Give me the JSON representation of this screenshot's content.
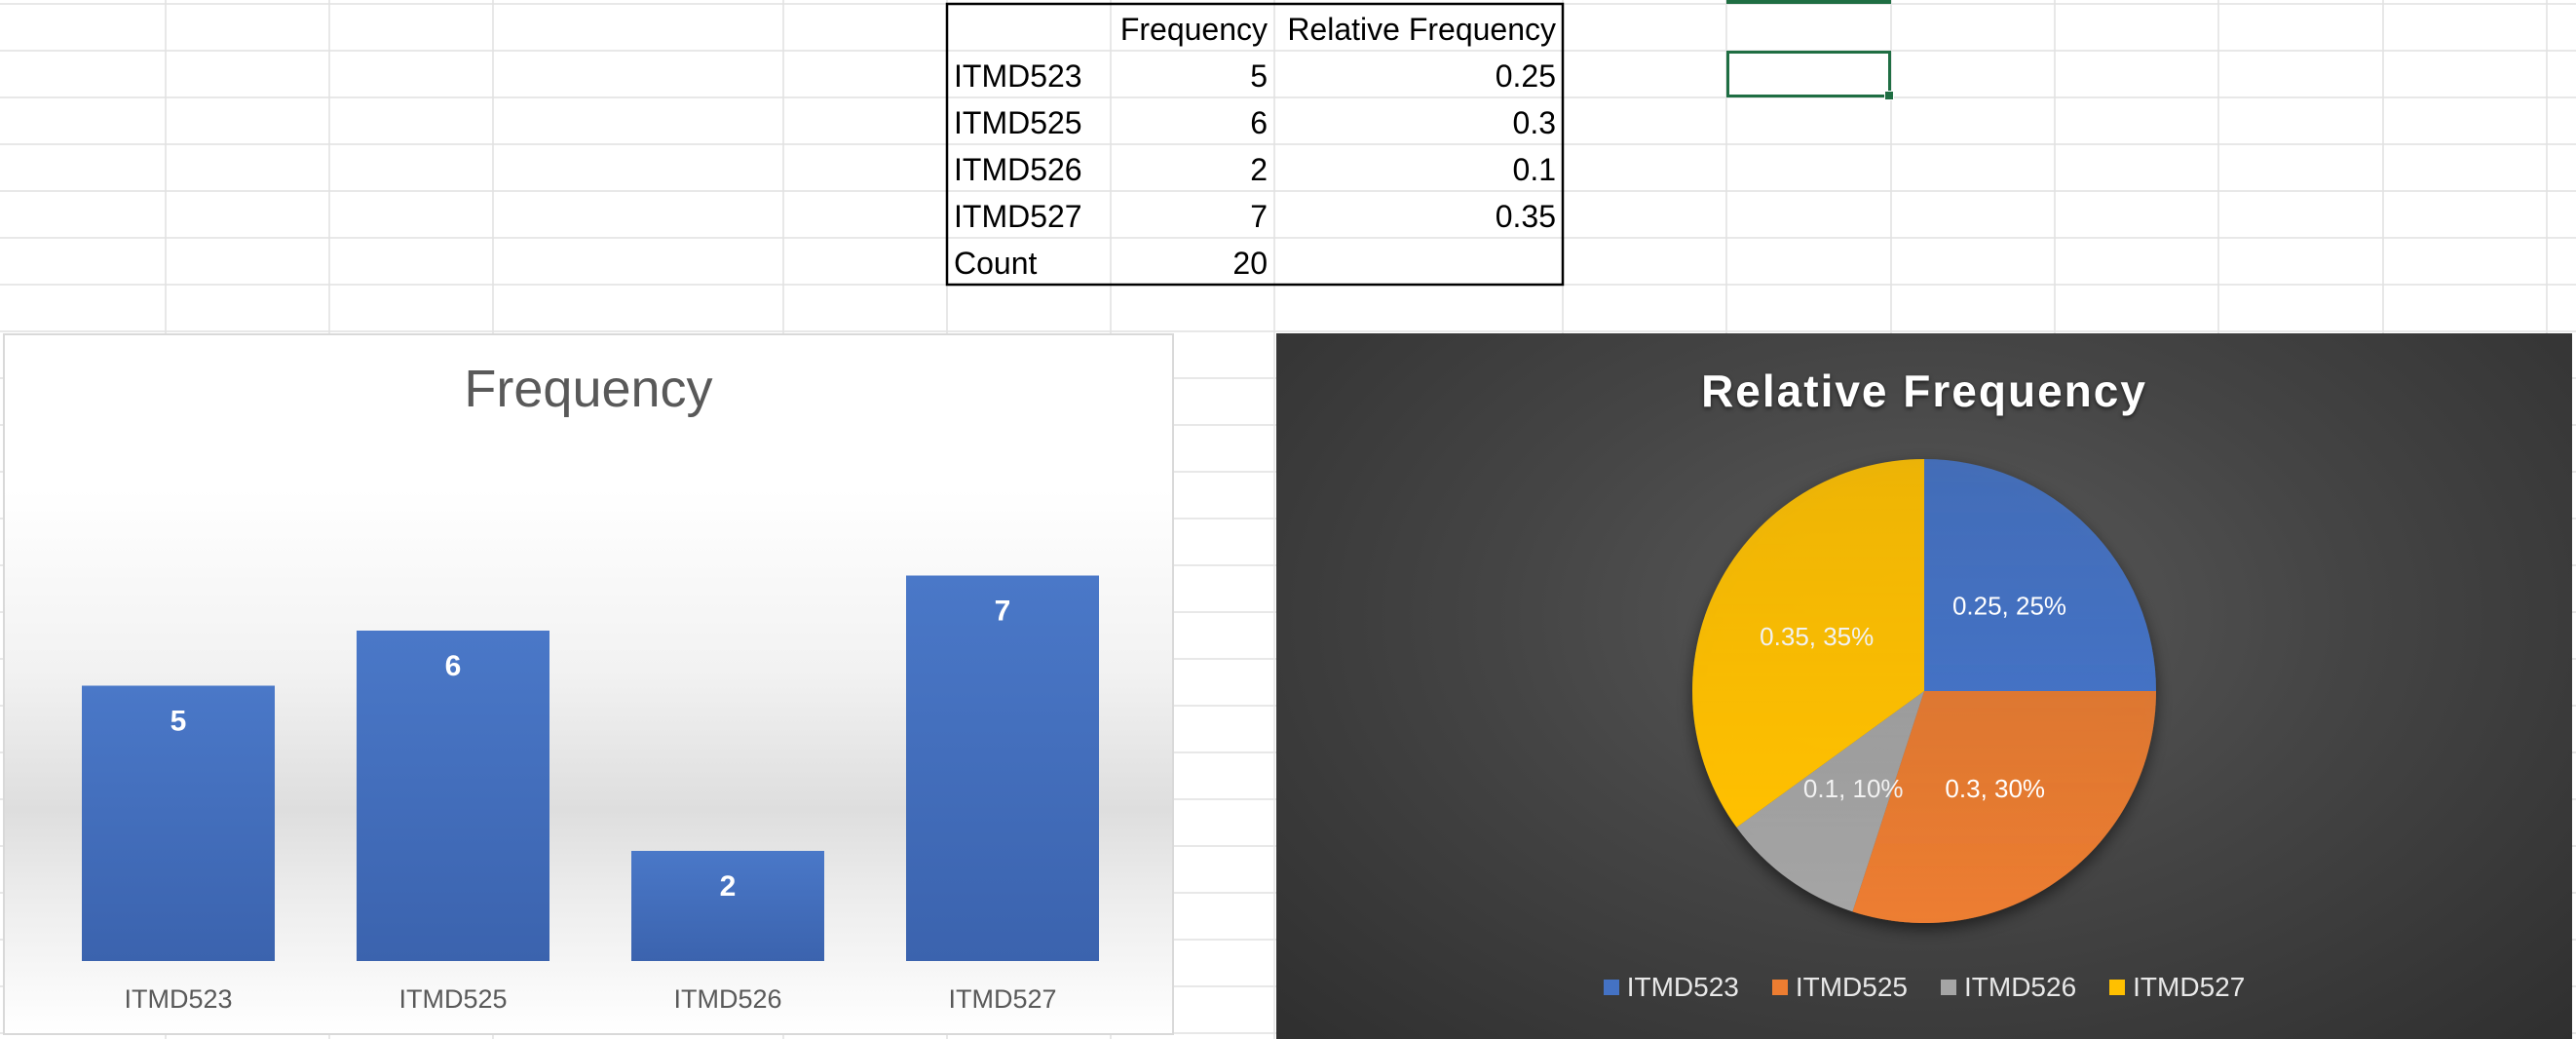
{
  "table": {
    "headers": [
      "",
      "Frequency",
      "Relative Frequency"
    ],
    "rows": [
      {
        "label": "ITMD523",
        "frequency": "5",
        "relative": "0.25"
      },
      {
        "label": "ITMD525",
        "frequency": "6",
        "relative": "0.3"
      },
      {
        "label": "ITMD526",
        "frequency": "2",
        "relative": "0.1"
      },
      {
        "label": "ITMD527",
        "frequency": "7",
        "relative": "0.35"
      }
    ],
    "count_label": "Count",
    "count_value": "20"
  },
  "chart_data": [
    {
      "type": "bar",
      "title": "Frequency",
      "categories": [
        "ITMD523",
        "ITMD525",
        "ITMD526",
        "ITMD527"
      ],
      "values": [
        5,
        6,
        2,
        7
      ],
      "data_labels": [
        "5",
        "6",
        "2",
        "7"
      ],
      "xlabel": "",
      "ylabel": "",
      "ylim": [
        0,
        8
      ],
      "grid": false,
      "legend": "none",
      "bar_color": "#4472c4"
    },
    {
      "type": "pie",
      "title": "Relative Frequency",
      "categories": [
        "ITMD523",
        "ITMD525",
        "ITMD526",
        "ITMD527"
      ],
      "values": [
        0.25,
        0.3,
        0.1,
        0.35
      ],
      "data_labels": [
        "0.25, 25%",
        "0.3, 30%",
        "0.1, 10%",
        "0.35, 35%"
      ],
      "colors": [
        "#4472c4",
        "#ed7d31",
        "#a5a5a5",
        "#ffc000"
      ],
      "legend": "bottom"
    }
  ]
}
